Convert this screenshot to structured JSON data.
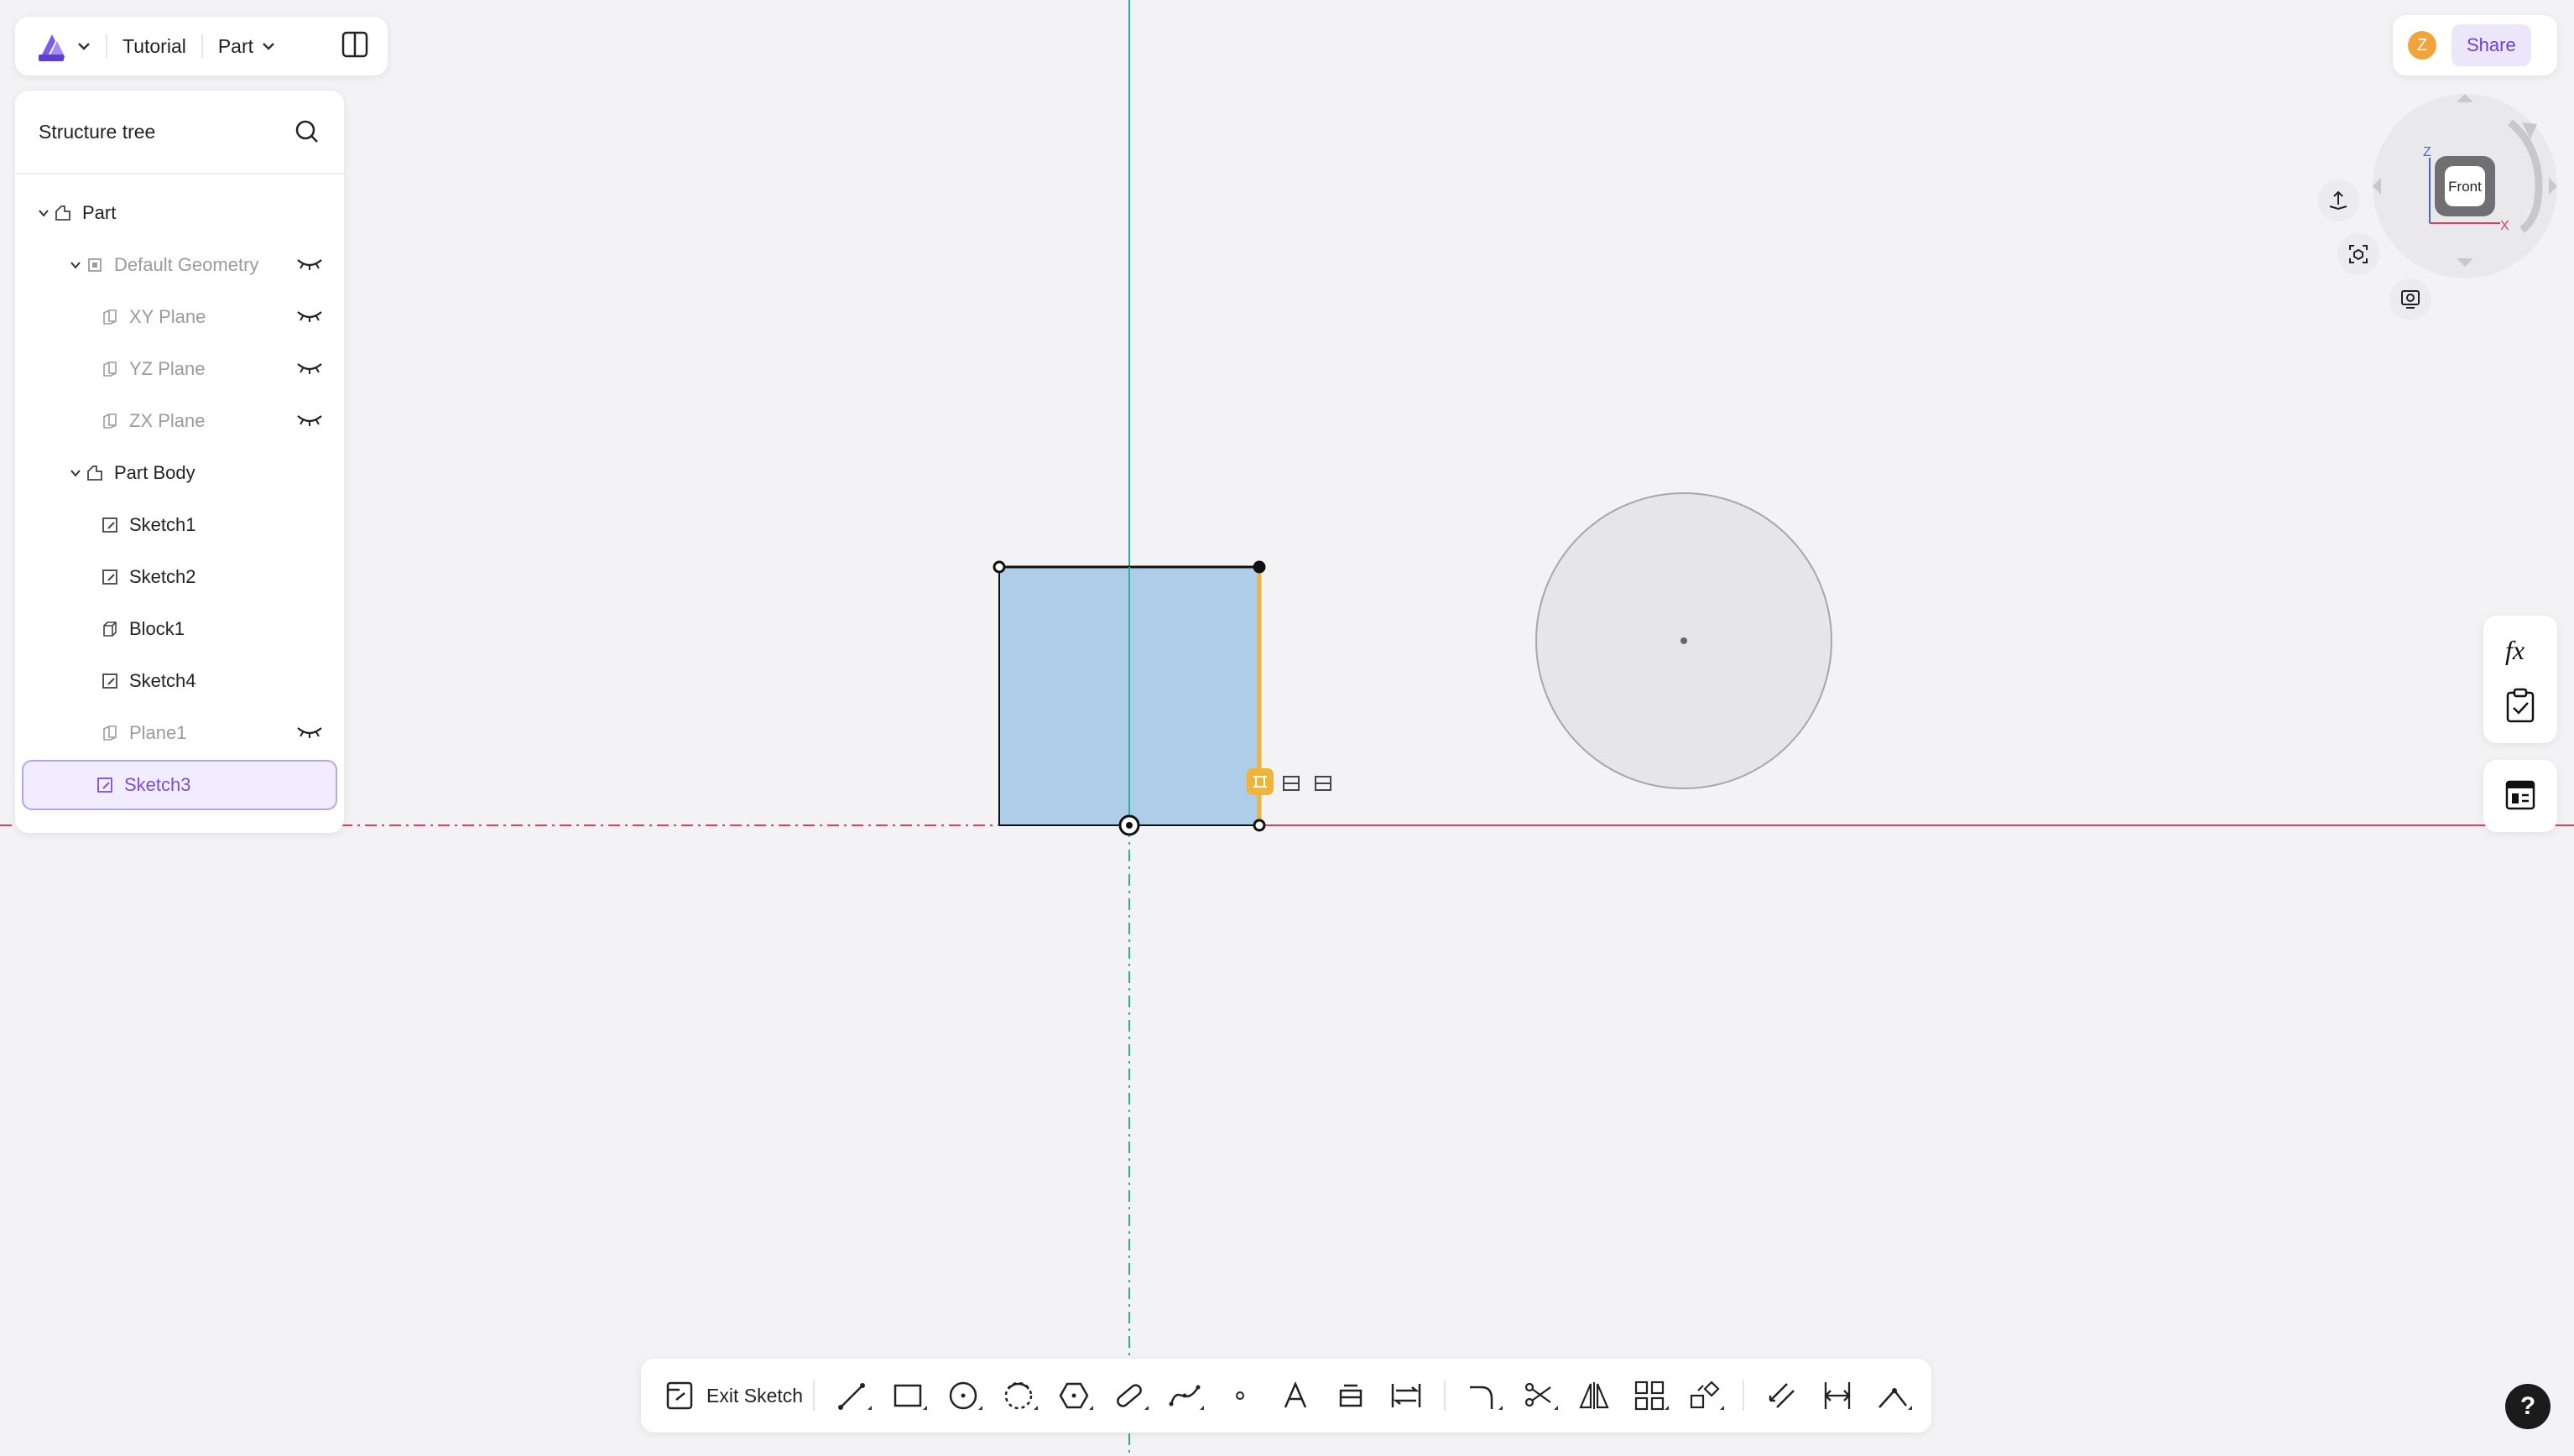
{
  "topbar": {
    "project": "Tutorial",
    "mode": "Part"
  },
  "tree": {
    "title": "Structure tree",
    "items": [
      {
        "label": "Part"
      },
      {
        "label": "Default Geometry"
      },
      {
        "label": "XY Plane"
      },
      {
        "label": "YZ Plane"
      },
      {
        "label": "ZX Plane"
      },
      {
        "label": "Part Body"
      },
      {
        "label": "Sketch1"
      },
      {
        "label": "Sketch2"
      },
      {
        "label": "Block1"
      },
      {
        "label": "Sketch4"
      },
      {
        "label": "Plane1"
      },
      {
        "label": "Sketch3"
      }
    ]
  },
  "user": {
    "initial": "Z"
  },
  "share_label": "Share",
  "viewcube": {
    "face": "Front",
    "axis_z": "Z",
    "axis_x": "X"
  },
  "toolbar": {
    "exit_label": "Exit Sketch"
  },
  "help_label": "?",
  "colors": {
    "accent": "#7c4ddb",
    "constraint": "#f0b43a",
    "x_axis": "#e0405a",
    "y_axis": "#2bb39a",
    "region_fill": "#aecde8"
  }
}
